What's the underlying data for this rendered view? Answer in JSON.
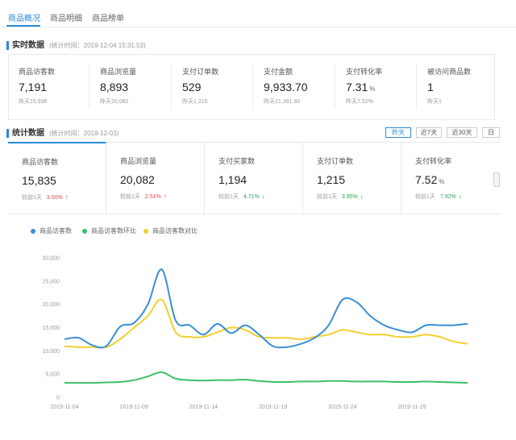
{
  "tabs": [
    {
      "label": "商品概况"
    },
    {
      "label": "商品明细"
    },
    {
      "label": "商品榜单"
    }
  ],
  "realtime": {
    "title": "实时数据",
    "update_time": "(统计时间：2019-12-04 15:31:53)",
    "items": [
      {
        "label": "商品访客数",
        "value": "7,191",
        "unit": "",
        "yesterday": "昨天15,936"
      },
      {
        "label": "商品浏览量",
        "value": "8,893",
        "unit": "",
        "yesterday": "昨天20,082"
      },
      {
        "label": "支付订单数",
        "value": "529",
        "unit": "",
        "yesterday": "昨天1,215"
      },
      {
        "label": "支付金额",
        "value": "9,933.70",
        "unit": "",
        "yesterday": "昨天21,391.60"
      },
      {
        "label": "支付转化率",
        "value": "7.31",
        "unit": "%",
        "yesterday": "昨天7.52%"
      },
      {
        "label": "被访问商品数",
        "value": "1",
        "unit": "",
        "yesterday": "昨天1"
      }
    ]
  },
  "stats": {
    "title": "统计数据",
    "stat_time": "(统计时间：2019-12-03)",
    "range_buttons": [
      "昨天",
      "近7天",
      "近30天",
      "日"
    ],
    "active_range": 0,
    "metrics": [
      {
        "label": "商品访客数",
        "value": "15,835",
        "unit": "",
        "cmp_label": "较前1天",
        "pct": "3.50%",
        "dir": "up"
      },
      {
        "label": "商品浏览量",
        "value": "20,082",
        "unit": "",
        "cmp_label": "较前1天",
        "pct": "2.51%",
        "dir": "up"
      },
      {
        "label": "支付买家数",
        "value": "1,194",
        "unit": "",
        "cmp_label": "较前1天",
        "pct": "4.71%",
        "dir": "down"
      },
      {
        "label": "支付订单数",
        "value": "1,215",
        "unit": "",
        "cmp_label": "较前1天",
        "pct": "3.95%",
        "dir": "down"
      },
      {
        "label": "支付转化率",
        "value": "7.52",
        "unit": "%",
        "cmp_label": "较前1天",
        "pct": "7.92%",
        "dir": "down"
      }
    ],
    "active_metric": 0
  },
  "colors": {
    "accent": "#2a8bd8",
    "series_blue": "#3a8fd5",
    "series_green": "#3cbf6a",
    "series_yellow": "#f2cf2e",
    "up": "#e0464d",
    "down": "#2aa256"
  },
  "chart_data": {
    "type": "line",
    "x": [
      "2019-11-04",
      "2019-11-05",
      "2019-11-06",
      "2019-11-07",
      "2019-11-08",
      "2019-11-09",
      "2019-11-10",
      "2019-11-11",
      "2019-11-12",
      "2019-11-13",
      "2019-11-14",
      "2019-11-15",
      "2019-11-16",
      "2019-11-17",
      "2019-11-18",
      "2019-11-19",
      "2019-11-20",
      "2019-11-21",
      "2019-11-22",
      "2019-11-23",
      "2019-11-24",
      "2019-11-25",
      "2019-11-26",
      "2019-11-27",
      "2019-11-28",
      "2019-11-29",
      "2019-11-30",
      "2019-12-01",
      "2019-12-02",
      "2019-12-03"
    ],
    "x_tick_labels": [
      "2019-11-04",
      "2019-11-09",
      "2019-11-14",
      "2019-11-19",
      "2019-11-24",
      "2019-11-29"
    ],
    "y_tick_labels": [
      "0",
      "5,000",
      "10,000",
      "15,000",
      "20,000",
      "25,000",
      "30,000"
    ],
    "ylim": [
      0,
      30000
    ],
    "grid": false,
    "legend_position": "top-left",
    "series": [
      {
        "name": "商品访客数",
        "color": "#3a8fd5",
        "values": [
          12500,
          12800,
          11200,
          11000,
          15200,
          16000,
          20000,
          27500,
          16500,
          15500,
          13500,
          15800,
          13800,
          15500,
          13500,
          11000,
          10800,
          11500,
          12800,
          15500,
          21000,
          20500,
          17500,
          15500,
          14500,
          14000,
          15500,
          15500,
          15500,
          15835
        ]
      },
      {
        "name": "商品访客数环比",
        "color": "#3cbf6a",
        "values": [
          3100,
          3100,
          3100,
          3200,
          3300,
          3700,
          4500,
          5400,
          4000,
          3700,
          3600,
          3700,
          3700,
          3800,
          3500,
          3300,
          3300,
          3400,
          3400,
          3500,
          3500,
          3400,
          3400,
          3400,
          3300,
          3300,
          3400,
          3300,
          3200,
          3100
        ]
      },
      {
        "name": "商品访客数对比",
        "color": "#f2cf2e",
        "values": [
          11000,
          10800,
          10800,
          10800,
          12500,
          15000,
          17500,
          21000,
          14000,
          13000,
          13000,
          14000,
          15000,
          14500,
          13000,
          12800,
          12800,
          12500,
          13000,
          13500,
          14500,
          14000,
          13500,
          13500,
          13000,
          13000,
          13500,
          13000,
          12000,
          11500
        ]
      }
    ]
  }
}
